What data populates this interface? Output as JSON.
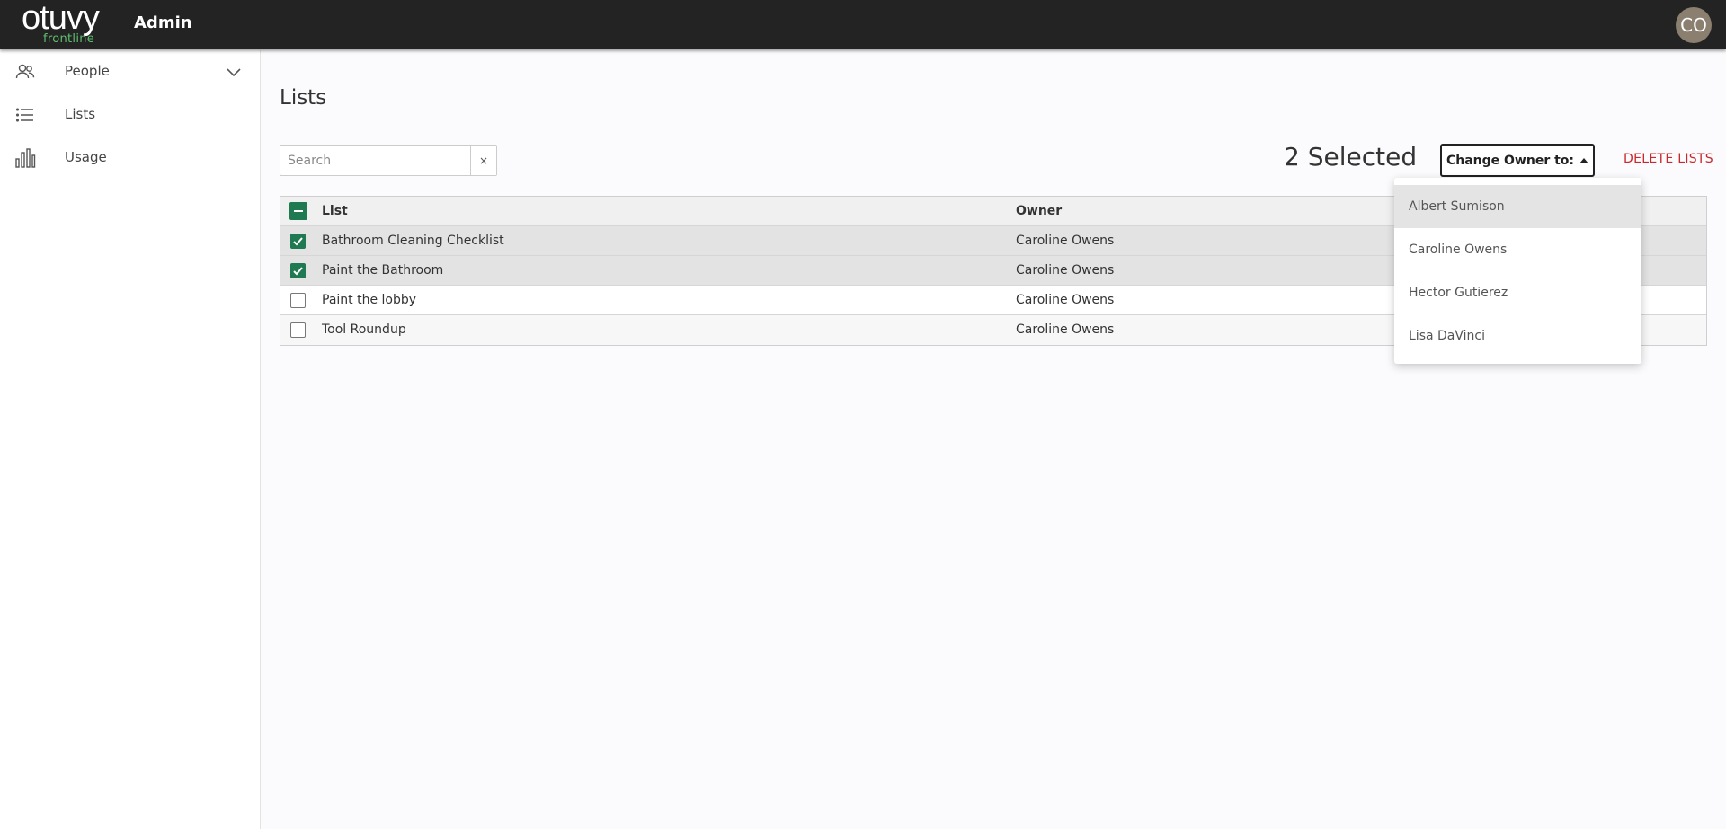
{
  "header": {
    "logo_text": "otuvy",
    "logo_sub": "frontline",
    "app_title": "Admin",
    "avatar_initials": "CO"
  },
  "sidebar": {
    "items": [
      {
        "label": "People",
        "icon": "people-icon",
        "expandable": true
      },
      {
        "label": "Lists",
        "icon": "list-icon"
      },
      {
        "label": "Usage",
        "icon": "bar-chart-icon"
      }
    ]
  },
  "main": {
    "title": "Lists",
    "search": {
      "placeholder": "Search",
      "value": "",
      "clear_label": "×"
    },
    "selected_text": "2 Selected",
    "change_owner_label": "Change Owner to:",
    "delete_label": "DELETE LISTS"
  },
  "table": {
    "columns": [
      "List",
      "Owner"
    ],
    "rows": [
      {
        "list": "Bathroom Cleaning Checklist",
        "owner": "Caroline Owens",
        "checked": true
      },
      {
        "list": "Paint the Bathroom",
        "owner": "Caroline Owens",
        "checked": true
      },
      {
        "list": "Paint the lobby",
        "owner": "Caroline Owens",
        "checked": false
      },
      {
        "list": "Tool Roundup",
        "owner": "Caroline Owens",
        "checked": false
      }
    ]
  },
  "owner_dropdown": {
    "options": [
      "Albert Sumison",
      "Caroline Owens",
      "Hector Gutierez",
      "Lisa DaVinci"
    ],
    "highlighted": "Albert Sumison"
  },
  "colors": {
    "topbar": "#232323",
    "brand_green": "#1f7a52",
    "logo_green": "#5fbf6f",
    "danger": "#c8292c",
    "avatar": "#8b7f70"
  }
}
